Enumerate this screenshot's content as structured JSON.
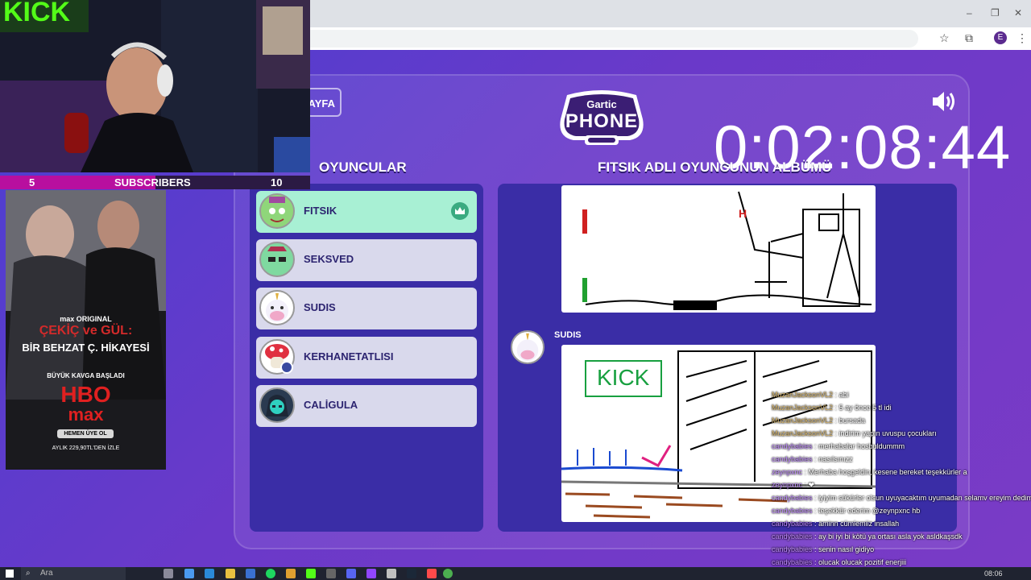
{
  "browser": {
    "window_controls": [
      "–",
      "❐",
      "✕"
    ],
    "profile_initial": "E"
  },
  "game": {
    "back_label": "AYFA",
    "logo_top": "Gartic",
    "logo_bottom": "PHONE",
    "timer": "0:02:08:44",
    "players_title": "OYUNCULAR",
    "album_title": "FITSIK ADLI OYUNCUNUN ALBÜMÜ",
    "players": [
      {
        "name": "FITSIK",
        "active": true,
        "host": true
      },
      {
        "name": "SEKSVED",
        "active": false
      },
      {
        "name": "SUDIS",
        "active": false
      },
      {
        "name": "KERHANETATLISI",
        "active": false
      },
      {
        "name": "CALİGULA",
        "active": false
      }
    ],
    "album_entry_author": "SUDIS",
    "drawing_text": "KICK"
  },
  "stream": {
    "webcam_sign": "KICK",
    "subs_current": "5",
    "subs_label": "SUBSCRIBERS",
    "subs_goal": "10",
    "subs_progress": 0.5
  },
  "ad": {
    "brand": "max ORIGINAL",
    "title1": "ÇEKİÇ ve GÜL:",
    "title2": "BİR BEHZAT Ç. HİKAYESİ",
    "tagline": "BÜYÜK KAVGA BAŞLADI",
    "hbo": "HBO",
    "max": "max",
    "cta": "HEMEN ÜYE OL",
    "price": "AYLIK 229,90TL'DEN İZLE"
  },
  "chat": [
    {
      "user": "MuzanJacksonVL2",
      "msg": "abi",
      "gold": true
    },
    {
      "user": "MuzanJacksonVL2",
      "msg": "5 ay önce 5 tl idi",
      "gold": true
    },
    {
      "user": "MuzanJacksonVL2",
      "msg": "bursada",
      "gold": true
    },
    {
      "user": "MuzanJacksonVL2",
      "msg": "indirim yapın uvuspu çocukları",
      "gold": true
    },
    {
      "user": "candybabies",
      "msg": "merhabalar hosbuldummm"
    },
    {
      "user": "candybabies",
      "msg": "nasılsınızz"
    },
    {
      "user": "zeynpxnc",
      "msg": "Merhaba hoşgeldin, kesene bereket teşekkürler a"
    },
    {
      "user": "zeynpxnc",
      "msg": "❤"
    },
    {
      "user": "candybabies",
      "msg": "iyiyim sükürler olsun uyuyacaktım uyumadan selamv ereyim dedimm"
    },
    {
      "user": "candybabies",
      "msg": "teşekkür ederim @zeynpxnc hb"
    },
    {
      "user": "candybabies",
      "msg": "aminn cümlemiiz insallah"
    },
    {
      "user": "candybabies",
      "msg": "ay bi iyi bi kötü ya ortası asla yok asldkaşsdk"
    },
    {
      "user": "candybabies",
      "msg": "senin nasıl gidiyo"
    },
    {
      "user": "candybabies",
      "msg": "olucak olucak pozitif enerjiii"
    }
  ],
  "taskbar": {
    "search_placeholder": "Ara",
    "time": "08:06"
  }
}
